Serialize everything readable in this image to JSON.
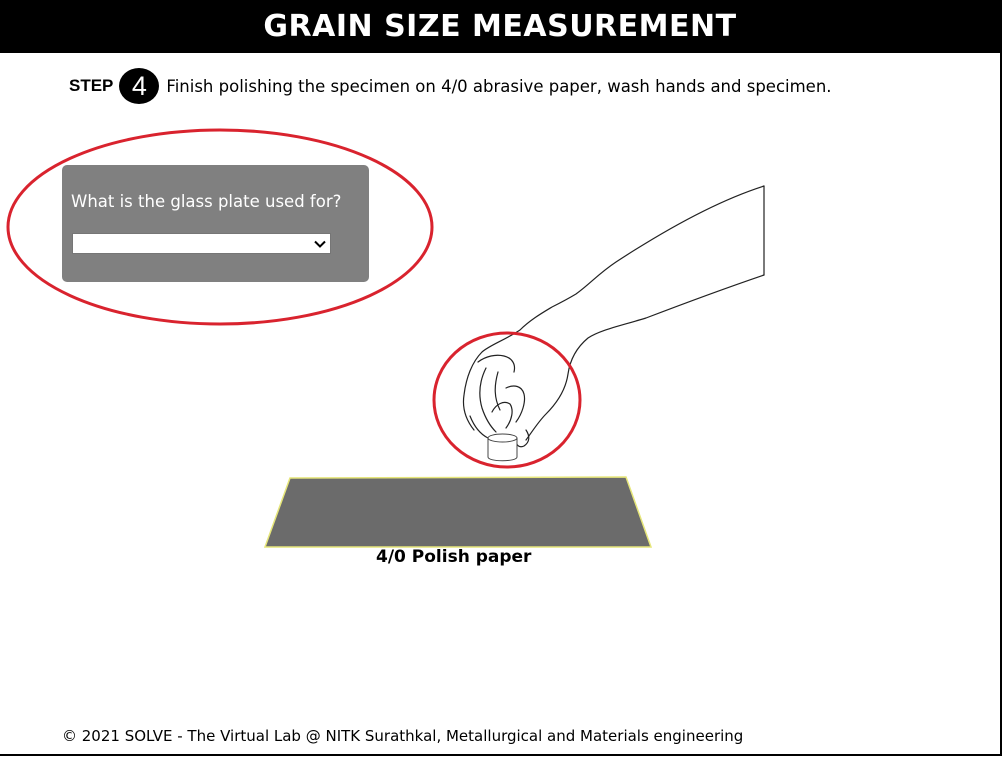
{
  "header": {
    "title": "GRAIN SIZE MEASUREMENT"
  },
  "step": {
    "label": "STEP",
    "number": "4",
    "instruction": "Finish polishing the specimen on 4/0 abrasive paper, wash hands and specimen."
  },
  "quiz": {
    "question": "What is the glass plate used for?",
    "selected_value": "",
    "panel_color": "#808080"
  },
  "illustration": {
    "paper_label": "4/0 Polish paper",
    "paper_color": "#6b6b6b",
    "paper_outline_color": "#e6e67a",
    "highlight_color": "#d9232e"
  },
  "footer": {
    "text": "© 2021 SOLVE - The Virtual Lab @ NITK Surathkal, Metallurgical and Materials engineering"
  },
  "icons": {
    "dropdown": "chevron-down-icon"
  }
}
